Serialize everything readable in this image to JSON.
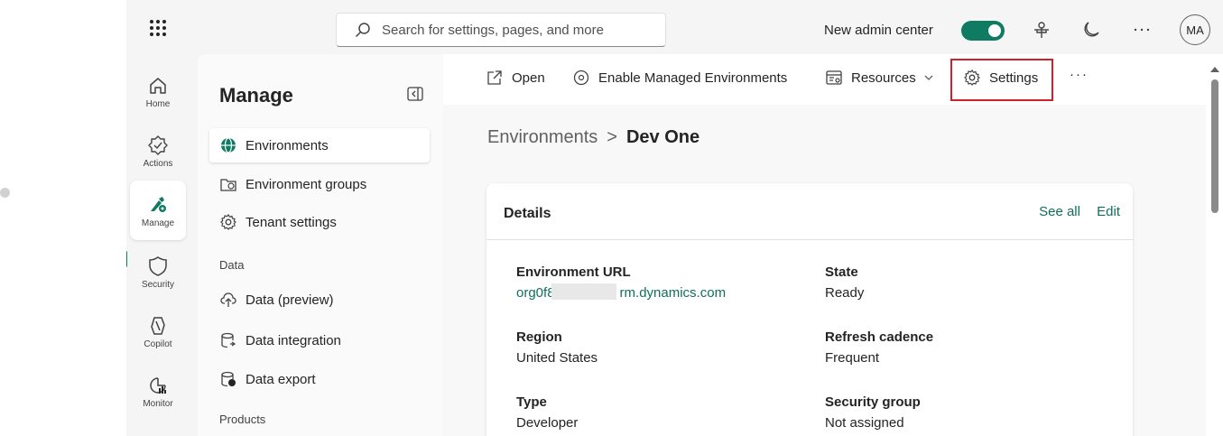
{
  "topbar": {
    "search_placeholder": "Search for settings, pages, and more",
    "new_admin_center_label": "New admin center",
    "new_admin_center_on": true,
    "avatar_initials": "MA"
  },
  "rail": {
    "items": [
      {
        "label": "Home",
        "icon": "home-icon"
      },
      {
        "label": "Actions",
        "icon": "actions-icon"
      },
      {
        "label": "Manage",
        "icon": "manage-icon",
        "active": true
      },
      {
        "label": "Security",
        "icon": "shield-icon"
      },
      {
        "label": "Copilot",
        "icon": "copilot-icon"
      },
      {
        "label": "Monitor",
        "icon": "monitor-icon"
      }
    ]
  },
  "manage": {
    "title": "Manage",
    "items": [
      {
        "label": "Environments",
        "icon": "globe-icon",
        "active": true
      },
      {
        "label": "Environment groups",
        "icon": "environment-groups-icon"
      },
      {
        "label": "Tenant settings",
        "icon": "gear-icon"
      }
    ],
    "data_header": "Data",
    "data_items": [
      {
        "label": "Data (preview)",
        "icon": "cloud-upload-icon"
      },
      {
        "label": "Data integration",
        "icon": "database-link-icon"
      },
      {
        "label": "Data export",
        "icon": "database-export-icon"
      }
    ],
    "products_header": "Products"
  },
  "commandbar": {
    "open": "Open",
    "enable_managed": "Enable Managed Environments",
    "resources": "Resources",
    "settings": "Settings",
    "more": "···"
  },
  "breadcrumb": {
    "parent": "Environments",
    "separator": ">",
    "current": "Dev One"
  },
  "details": {
    "title": "Details",
    "see_all": "See all",
    "edit": "Edit",
    "fields": [
      {
        "label": "Environment URL",
        "value": "org0f8****.crm.dynamics.com",
        "visible_value_start": "org0f8",
        "visible_value_end": "rm.dynamics.com"
      },
      {
        "label": "State",
        "value": "Ready"
      },
      {
        "label": "Region",
        "value": "United States"
      },
      {
        "label": "Refresh cadence",
        "value": "Frequent"
      },
      {
        "label": "Type",
        "value": "Developer"
      },
      {
        "label": "Security group",
        "value": "Not assigned"
      }
    ]
  },
  "colors": {
    "accent": "#0f7b63",
    "highlight_border": "#d0202a",
    "link": "#0f6f5c"
  }
}
